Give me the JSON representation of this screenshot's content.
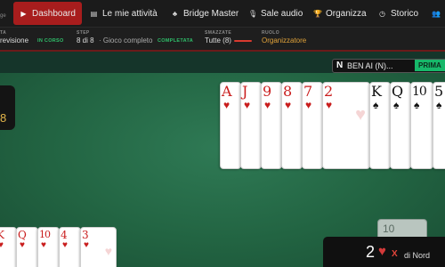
{
  "nav": {
    "logo_suffix": "ge",
    "items": [
      {
        "label": "Dashboard",
        "icon": "play-icon",
        "glyph": "▶",
        "active": true
      },
      {
        "label": "Le mie attività",
        "icon": "document-icon",
        "glyph": "▤"
      },
      {
        "label": "Bridge Master",
        "icon": "bridge-icon",
        "glyph": "♣"
      },
      {
        "label": "Sale audio",
        "icon": "microphone-icon",
        "glyph": "🎙"
      },
      {
        "label": "Organizza",
        "icon": "trophy-icon",
        "glyph": "🏆"
      },
      {
        "label": "Storico",
        "icon": "clock-icon",
        "glyph": "◷"
      },
      {
        "label": "",
        "icon": "users-icon",
        "glyph": "👥"
      }
    ]
  },
  "info": {
    "type_label": "TA",
    "type_value": "revisione",
    "type_status": "IN CORSO",
    "step_label": "STEP",
    "step_value": "8 di 8",
    "step_desc": "· Gioco completo",
    "step_status": "COMPLETATA",
    "tricks_label": "SMAZZATE",
    "tricks_value": "Tutte (8)",
    "role_label": "RUOLO",
    "role_value": "Organizzatore"
  },
  "table": {
    "left_value": "8",
    "player": {
      "seat": "N",
      "name": "BEN AI (N)...",
      "tag": "PRIMA"
    },
    "north_hand": [
      {
        "rank": "A",
        "suit": "♥",
        "color": "red"
      },
      {
        "rank": "J",
        "suit": "♥",
        "color": "red"
      },
      {
        "rank": "9",
        "suit": "♥",
        "color": "red"
      },
      {
        "rank": "8",
        "suit": "♥",
        "color": "red"
      },
      {
        "rank": "7",
        "suit": "♥",
        "color": "red"
      },
      {
        "rank": "2",
        "suit": "♥",
        "color": "red"
      },
      {
        "rank": "K",
        "suit": "♠",
        "color": "black"
      },
      {
        "rank": "Q",
        "suit": "♠",
        "color": "black"
      },
      {
        "rank": "10",
        "suit": "♠",
        "color": "black"
      },
      {
        "rank": "5",
        "suit": "♠",
        "color": "black"
      }
    ],
    "south_hand": [
      {
        "rank": "K",
        "suit": "♥",
        "color": "red"
      },
      {
        "rank": "Q",
        "suit": "♥",
        "color": "red"
      },
      {
        "rank": "10",
        "suit": "♥",
        "color": "red"
      },
      {
        "rank": "4",
        "suit": "♥",
        "color": "red"
      },
      {
        "rank": "3",
        "suit": "♥",
        "color": "red"
      },
      {
        "rank": "",
        "suit": "♠",
        "color": "red"
      }
    ],
    "played_card_value": "10",
    "bid": {
      "level": "2",
      "suit": "♥",
      "double": "X",
      "text": "di Nord"
    }
  },
  "colors": {
    "accent": "#a81d1d",
    "felt": "#226442",
    "status_green": "#2fbf6a",
    "role_orange": "#e0a23a",
    "tag_green": "#17b86a"
  }
}
